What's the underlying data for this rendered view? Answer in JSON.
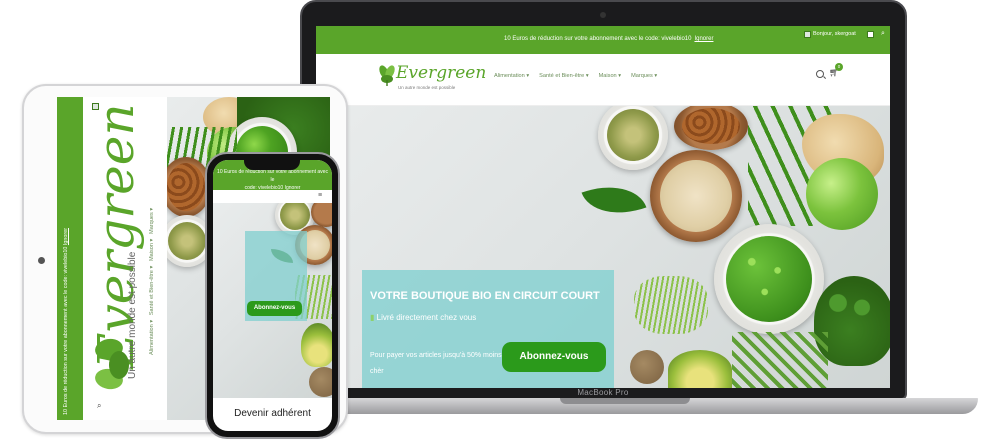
{
  "macbook": {
    "device_label": "MacBook Pro",
    "promo": {
      "text": "10 Euros de réduction sur votre abonnement avec le code: vivelebio10",
      "ignore": "Ignorer",
      "user": "Bonjour, skergoat"
    },
    "header": {
      "logo": "Evergreen",
      "tagline": "Un autre monde est possible",
      "menu": [
        "Alimentation",
        "Santé et Bien-être",
        "Maison",
        "Marques"
      ],
      "cart_count": "0"
    },
    "hero": {
      "title": "VOTRE BOUTIQUE BIO EN CIRCUIT COURT",
      "subtitle": "Livré directement chez vous",
      "text": "Pour payer vos articles jusqu'à 50% moins chèr",
      "button": "Abonnez-vous"
    }
  },
  "ipad": {
    "promo": "10 Euros de réduction sur votre abonnement avec le code: vivelebio10",
    "ignore": "Ignorer",
    "logo": "Evergreen",
    "tagline": "Un autre monde est possible",
    "menu": [
      "Alimentation",
      "Santé et Bien-être",
      "Maison",
      "Marques"
    ]
  },
  "iphone": {
    "promo_line1": "10 Euros de réduction sur votre abonnement avec le",
    "promo_line2": "code: vivelebio10",
    "ignore": "Ignorer",
    "button": "Abonnez-vous",
    "adherent": "Devenir adhérent"
  },
  "colors": {
    "brand_green": "#5aa52a",
    "button_green": "#2b9a1b",
    "hero_panel": "#80cfcf"
  }
}
